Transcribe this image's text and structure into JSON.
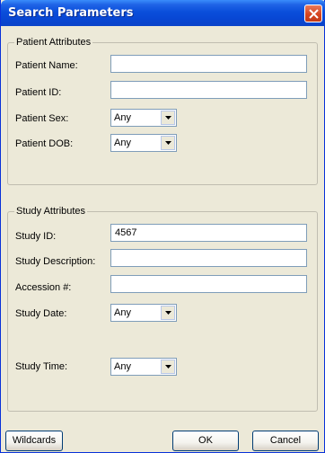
{
  "window": {
    "title": "Search Parameters"
  },
  "patient": {
    "legend": "Patient Attributes",
    "name_label": "Patient Name:",
    "name_value": "",
    "id_label": "Patient ID:",
    "id_value": "",
    "sex_label": "Patient Sex:",
    "sex_value": "Any",
    "dob_label": "Patient DOB:",
    "dob_value": "Any"
  },
  "study": {
    "legend": "Study Attributes",
    "id_label": "Study ID:",
    "id_value": "4567",
    "desc_label": "Study Description:",
    "desc_value": "",
    "accession_label": "Accession #:",
    "accession_value": "",
    "date_label": "Study Date:",
    "date_value": "Any",
    "time_label": "Study Time:",
    "time_value": "Any"
  },
  "buttons": {
    "wildcards": "Wildcards",
    "ok": "OK",
    "cancel": "Cancel"
  },
  "colors": {
    "titlebar": "#0a4fdb",
    "close": "#d6451f",
    "dialog_bg": "#ece9d8",
    "field_border": "#7f9db9"
  }
}
